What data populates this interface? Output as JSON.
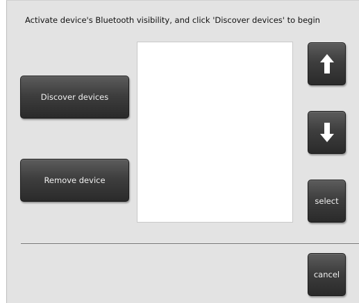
{
  "instruction": "Activate device's Bluetooth visibility, and click 'Discover devices' to begin",
  "buttons": {
    "discover": "Discover devices",
    "remove": "Remove device",
    "select": "select",
    "cancel": "cancel"
  },
  "icons": {
    "up": "arrow-up-icon",
    "down": "arrow-down-icon"
  },
  "device_list": {
    "items": []
  },
  "colors": {
    "background": "#e3e3e3",
    "button": "#3e3e3e",
    "button_text": "#f2f2f2",
    "list_background": "#ffffff"
  }
}
